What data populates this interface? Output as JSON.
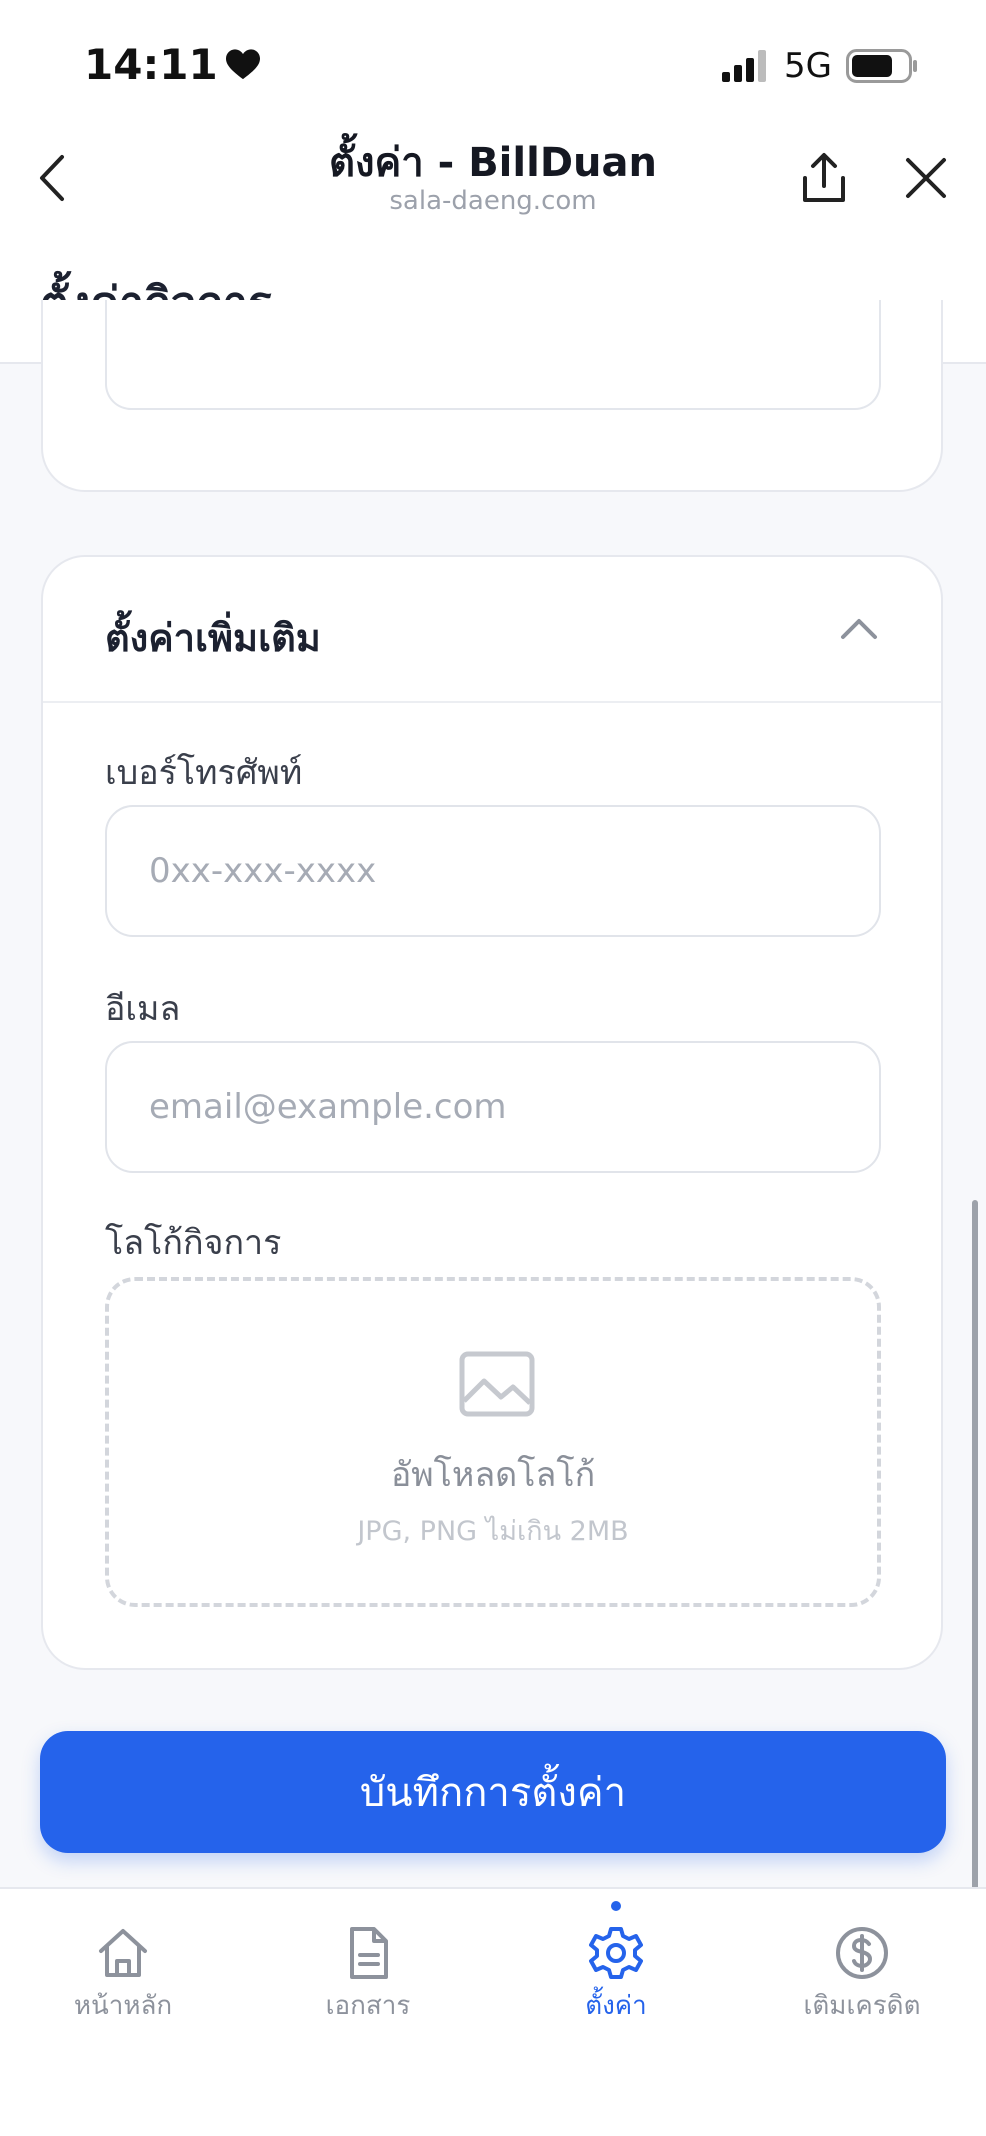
{
  "status_bar": {
    "time": "14:11",
    "network": "5G"
  },
  "browser": {
    "title": "ตั้งค่า - BillDuan",
    "url": "sala-daeng.com"
  },
  "page": {
    "title": "ตั้งค่ากิจการ"
  },
  "additional_settings": {
    "title": "ตั้งค่าเพิ่มเติม",
    "phone": {
      "label": "เบอร์โทรศัพท์",
      "placeholder": "0xx-xxx-xxxx",
      "value": ""
    },
    "email": {
      "label": "อีเมล",
      "placeholder": "email@example.com",
      "value": ""
    },
    "logo": {
      "label": "โลโก้กิจการ",
      "upload_text": "อัพโหลดโลโก้",
      "hint": "JPG, PNG ไม่เกิน 2MB"
    }
  },
  "save_button": {
    "label": "บันทึกการตั้งค่า"
  },
  "bottom_nav": {
    "items": [
      {
        "label": "หน้าหลัก",
        "icon": "home-icon",
        "active": false
      },
      {
        "label": "เอกสาร",
        "icon": "document-icon",
        "active": false
      },
      {
        "label": "ตั้งค่า",
        "icon": "gear-icon",
        "active": true
      },
      {
        "label": "เติมเครดิต",
        "icon": "dollar-icon",
        "active": false
      }
    ]
  },
  "colors": {
    "accent": "#2563eb",
    "muted": "#8d929c",
    "border": "#e1e4ea"
  }
}
